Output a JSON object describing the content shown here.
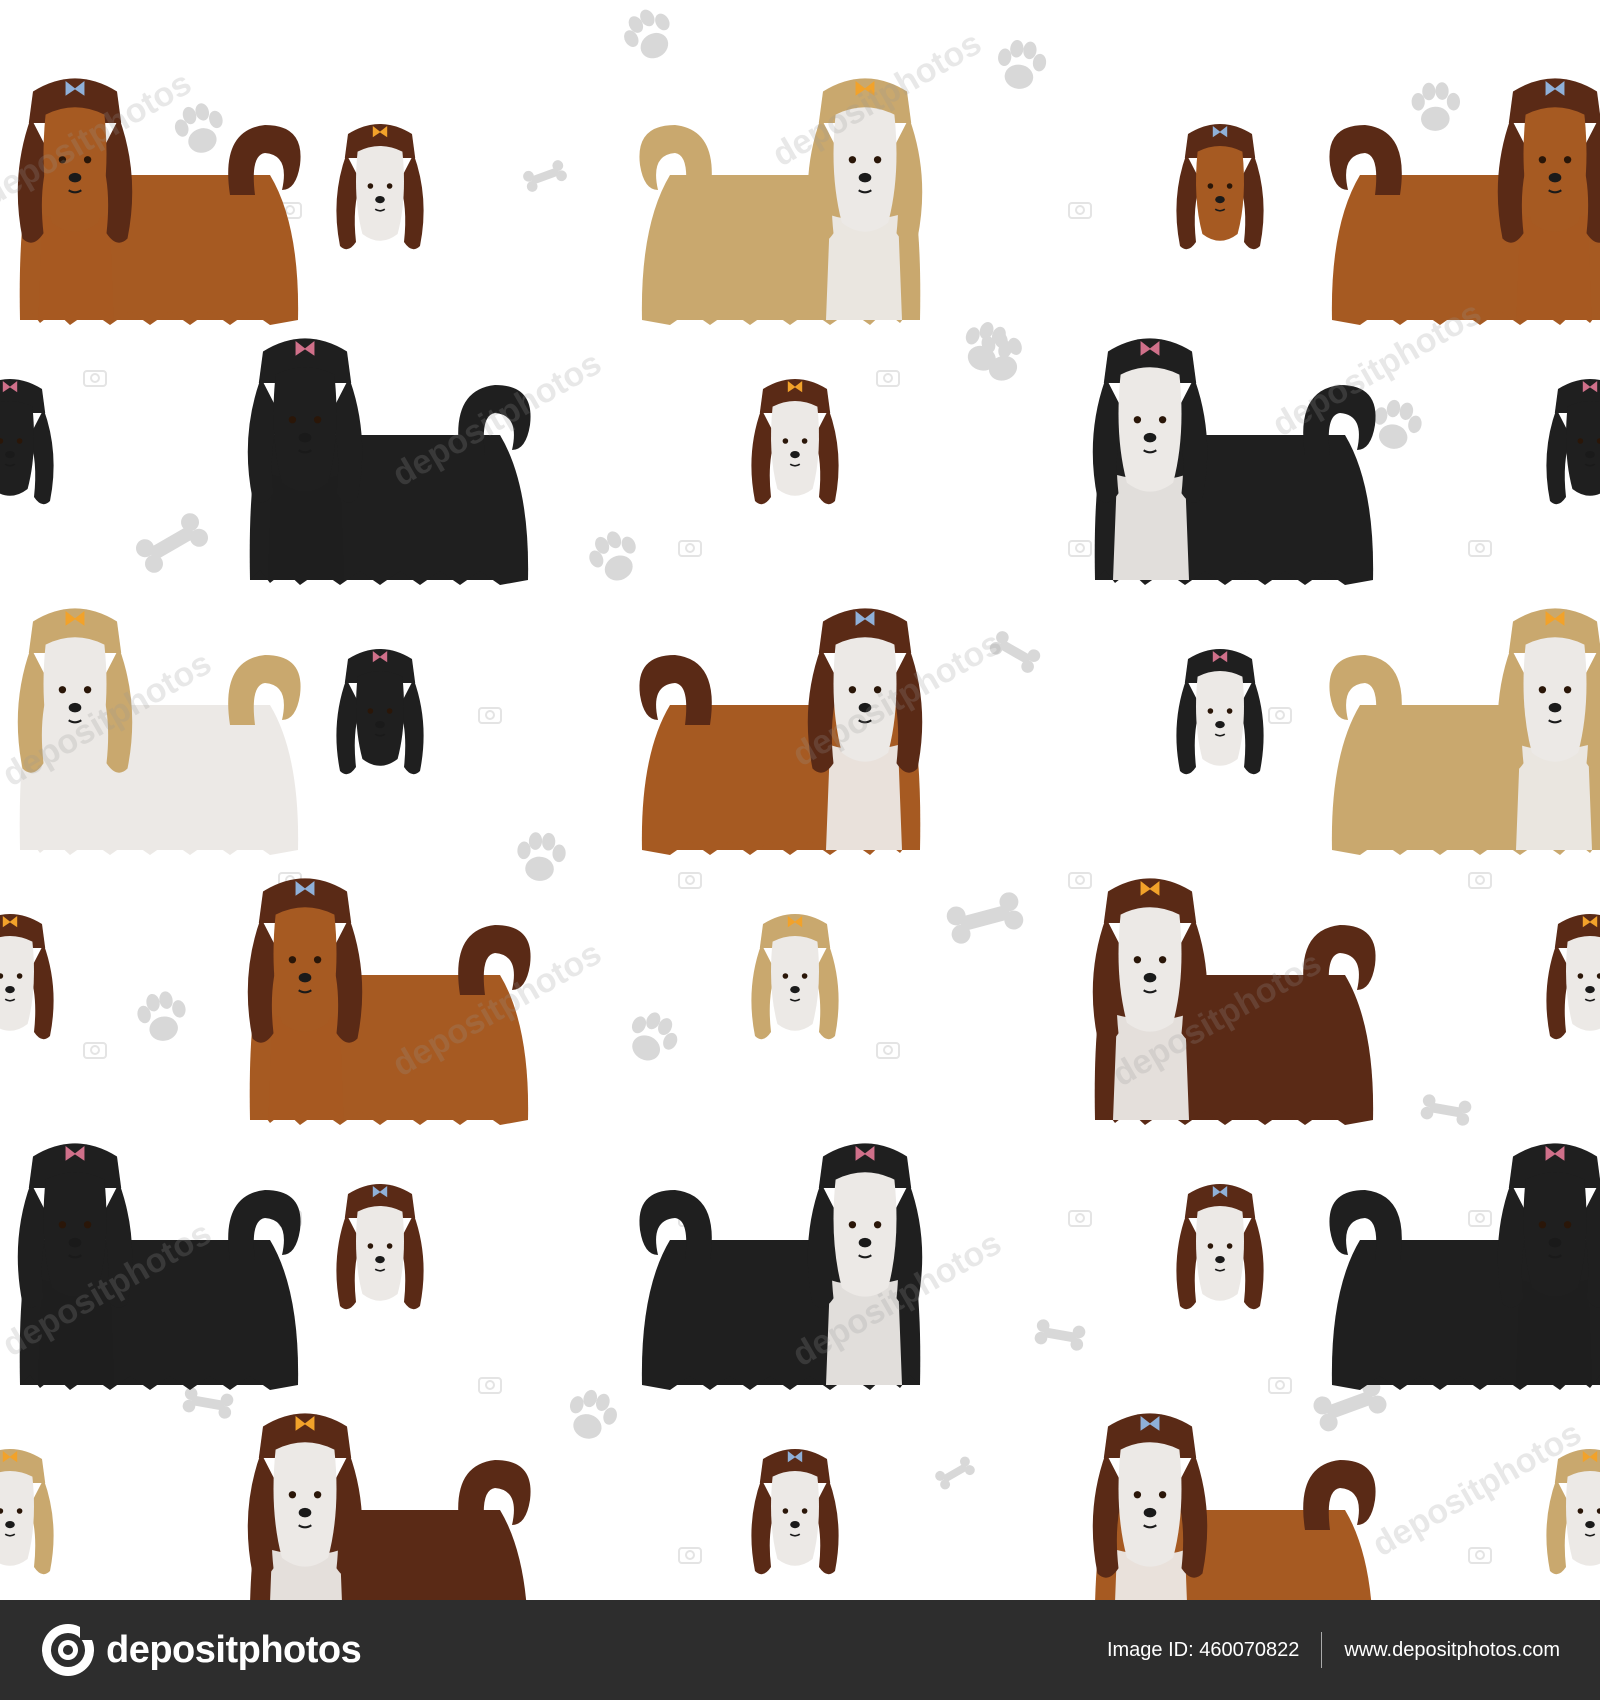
{
  "footer": {
    "brand": "depositphotos",
    "image_id": "Image ID: 460070822",
    "url": "www.depositphotos.com"
  },
  "watermark_text": "depositphotos",
  "colors": {
    "background": "#ffffff",
    "footer_bg": "#2d2d2d",
    "paw": "#d8d8d8",
    "coats": {
      "red": "#a65a22",
      "liver": "#5a2a16",
      "gold": "#c9a86e",
      "black": "#1f1f1f",
      "white": "#ece9e6"
    },
    "bows": [
      "#8fb0d8",
      "#f2a22a",
      "#d0708a"
    ]
  },
  "icons": [
    "paw-print-icon",
    "bone-icon",
    "camera-icon",
    "depositphotos-logo-icon"
  ]
}
